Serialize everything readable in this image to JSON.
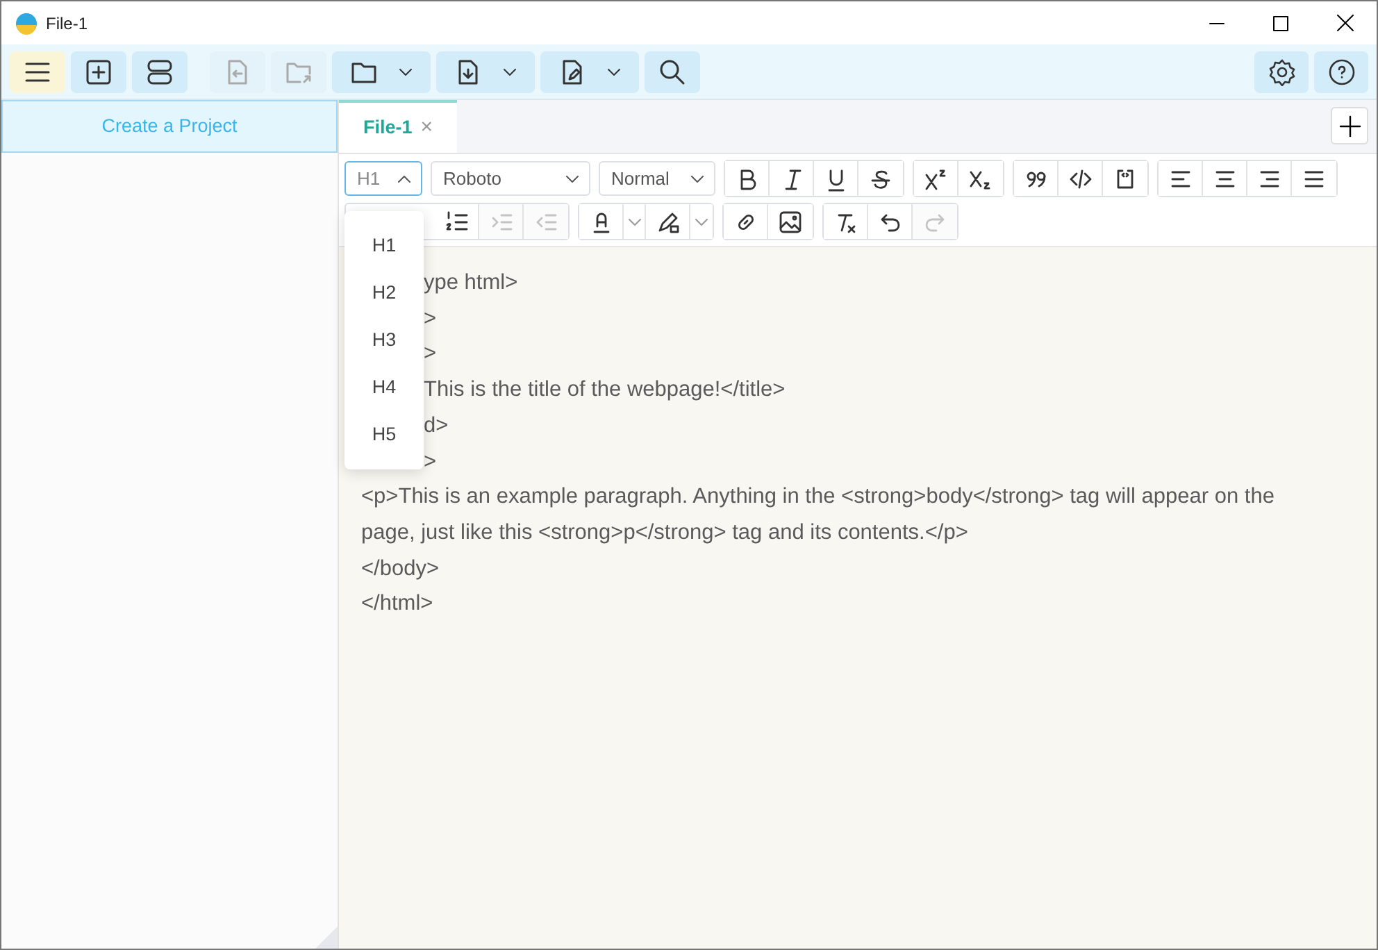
{
  "window": {
    "title": "File-1"
  },
  "toolbar": {
    "left": [
      {
        "kind": "menu",
        "on": true,
        "disabled": false
      },
      {
        "kind": "new",
        "on": false,
        "disabled": false
      },
      {
        "kind": "layout",
        "on": false,
        "disabled": false
      },
      {
        "kind": "import",
        "on": false,
        "disabled": true
      },
      {
        "kind": "export",
        "on": false,
        "disabled": true
      },
      {
        "kind": "folder",
        "on": false,
        "disabled": false,
        "dropdown": true
      },
      {
        "kind": "save",
        "on": false,
        "disabled": false,
        "dropdown": true
      },
      {
        "kind": "edit",
        "on": false,
        "disabled": false,
        "dropdown": true
      },
      {
        "kind": "search",
        "on": false,
        "disabled": false
      }
    ],
    "right": [
      {
        "kind": "settings"
      },
      {
        "kind": "help"
      }
    ]
  },
  "sidebar": {
    "header": "Create a Project"
  },
  "tabs": [
    {
      "label": "File-1",
      "selected": true,
      "close": "×"
    }
  ],
  "editor_toolbar": {
    "selects": [
      {
        "kind": "heading",
        "value": "H1",
        "expanded": true
      },
      {
        "kind": "font",
        "value": "Roboto",
        "expanded": false
      },
      {
        "kind": "size",
        "value": "Normal",
        "expanded": false
      }
    ],
    "row1": [
      [
        {
          "kind": "bold",
          "disabled": false
        },
        {
          "kind": "italic",
          "disabled": false
        },
        {
          "kind": "underline",
          "disabled": false
        },
        {
          "kind": "strike",
          "disabled": false
        }
      ],
      [
        {
          "kind": "sup",
          "disabled": false
        },
        {
          "kind": "sub",
          "disabled": false
        }
      ],
      [
        {
          "kind": "quote",
          "disabled": false
        },
        {
          "kind": "code",
          "disabled": false
        },
        {
          "kind": "codeblock",
          "disabled": false
        }
      ],
      [
        {
          "kind": "alignleft",
          "disabled": false
        },
        {
          "kind": "aligncenter",
          "disabled": false
        },
        {
          "kind": "alignright",
          "disabled": false
        },
        {
          "kind": "justify",
          "disabled": false
        }
      ]
    ],
    "row2": [
      [
        {
          "kind": "ordered",
          "disabled": false
        },
        {
          "kind": "indent",
          "disabled": true
        },
        {
          "kind": "outdent",
          "disabled": true
        }
      ],
      [
        {
          "kind": "color",
          "disabled": false,
          "dropdown": true
        },
        {
          "kind": "highlight",
          "disabled": false,
          "dropdown": true
        }
      ],
      [
        {
          "kind": "link",
          "disabled": false
        },
        {
          "kind": "image",
          "disabled": false
        }
      ],
      [
        {
          "kind": "clear",
          "disabled": false
        },
        {
          "kind": "undo",
          "disabled": false
        },
        {
          "kind": "redo",
          "disabled": true
        }
      ]
    ]
  },
  "heading_menu": [
    "H1",
    "H2",
    "H3",
    "H4",
    "H5"
  ],
  "editor_lines": [
    {
      "kind": "covered",
      "text": "ype html>"
    },
    {
      "kind": "covered",
      "text": ">"
    },
    {
      "kind": "covered",
      "text": ">"
    },
    {
      "kind": "covered",
      "text": "This is the title of the webpage!</title>"
    },
    {
      "kind": "covered",
      "text": "d>"
    },
    {
      "kind": "covered",
      "text": ">"
    },
    {
      "kind": "full",
      "text": "<p>This is an example paragraph. Anything in the <strong>body</strong> tag will appear on the page, just like this <strong>p</strong> tag and its contents.</p>"
    },
    {
      "kind": "full",
      "text": "</body>"
    },
    {
      "kind": "full",
      "text": "</html>"
    }
  ]
}
